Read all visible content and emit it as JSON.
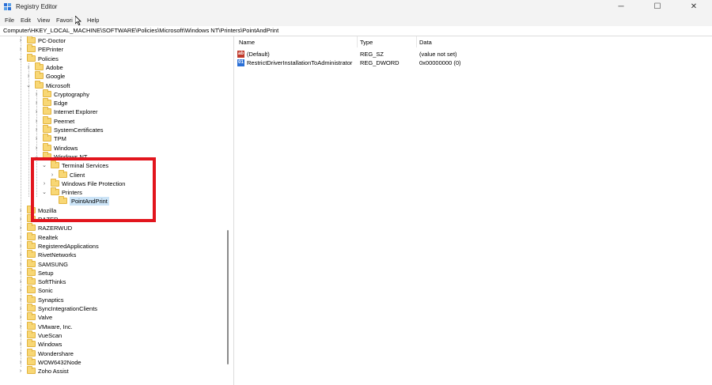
{
  "window": {
    "title": "Registry Editor",
    "controls": {
      "minimize": "─",
      "maximize": "☐",
      "close": "✕"
    }
  },
  "menu": [
    "File",
    "Edit",
    "View",
    "Favori",
    "Help"
  ],
  "address": "Computer\\HKEY_LOCAL_MACHINE\\SOFTWARE\\Policies\\Microsoft\\Windows NT\\Printers\\PointAndPrint",
  "tree": [
    {
      "label": "PC-Doctor",
      "expanded": false
    },
    {
      "label": "PEPrinter",
      "expanded": false
    },
    {
      "label": "Policies",
      "expanded": true
    },
    {
      "label": "Adobe",
      "expanded": false
    },
    {
      "label": "Google",
      "expanded": false
    },
    {
      "label": "Microsoft",
      "expanded": true
    },
    {
      "label": "Cryptography",
      "expanded": false
    },
    {
      "label": "Edge",
      "expanded": false
    },
    {
      "label": "Internet Explorer",
      "expanded": false
    },
    {
      "label": "Peernet",
      "expanded": false
    },
    {
      "label": "SystemCertificates",
      "expanded": false
    },
    {
      "label": "TPM",
      "expanded": false
    },
    {
      "label": "Windows",
      "expanded": false
    },
    {
      "label": "Windows NT",
      "expanded": true
    },
    {
      "label": "Terminal Services",
      "expanded": true
    },
    {
      "label": "Client",
      "expanded": false
    },
    {
      "label": "Windows File Protection",
      "expanded": false
    },
    {
      "label": "Printers",
      "expanded": true
    },
    {
      "label": "PointAndPrint",
      "selected": true
    },
    {
      "label": "Mozilla",
      "expanded": false
    },
    {
      "label": "RAZER",
      "expanded": false
    },
    {
      "label": "RAZERWUD",
      "expanded": false
    },
    {
      "label": "Realtek",
      "expanded": false
    },
    {
      "label": "RegisteredApplications",
      "expanded": false
    },
    {
      "label": "RivetNetworks",
      "expanded": false
    },
    {
      "label": "SAMSUNG",
      "expanded": false
    },
    {
      "label": "Setup",
      "expanded": false
    },
    {
      "label": "SoftThinks",
      "expanded": false
    },
    {
      "label": "Sonic",
      "expanded": false
    },
    {
      "label": "Synaptics",
      "expanded": false
    },
    {
      "label": "SyncIntegrationClients",
      "expanded": false
    },
    {
      "label": "Valve",
      "expanded": false
    },
    {
      "label": "VMware, Inc.",
      "expanded": false
    },
    {
      "label": "VueScan",
      "expanded": false
    },
    {
      "label": "Windows",
      "expanded": false
    },
    {
      "label": "Wondershare",
      "expanded": false
    },
    {
      "label": "WOW6432Node",
      "expanded": false
    },
    {
      "label": "Zoho Assist",
      "expanded": false
    }
  ],
  "list": {
    "columns": [
      "Name",
      "Type",
      "Data"
    ],
    "rows": [
      {
        "icon": "reg-sz-icon",
        "name": "(Default)",
        "type": "REG_SZ",
        "data": "(value not set)"
      },
      {
        "icon": "reg-dword-icon",
        "name": "RestrictDriverInstallationToAdministrator",
        "type": "REG_DWORD",
        "data": "0x00000000 (0)"
      }
    ]
  },
  "colors": {
    "highlight": "#e2151d",
    "folder": "#f8d775",
    "selection": "#cce4f7"
  }
}
